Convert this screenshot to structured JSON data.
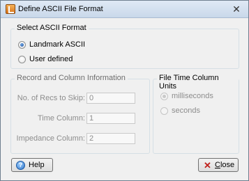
{
  "window": {
    "title": "Define ASCII File Format",
    "close_glyph": "✕"
  },
  "format_group": {
    "label": "Select ASCII Format",
    "options": [
      {
        "label": "Landmark ASCII",
        "checked": true
      },
      {
        "label": "User defined",
        "checked": false
      }
    ]
  },
  "record_group": {
    "label": "Record and Column Information",
    "fields": [
      {
        "label": "No. of Recs to Skip:",
        "value": "0"
      },
      {
        "label": "Time Column:",
        "value": "1"
      },
      {
        "label": "Impedance Column:",
        "value": "2"
      }
    ]
  },
  "units_group": {
    "label": "File Time Column Units",
    "options": [
      {
        "label": "milliseconds",
        "checked": true
      },
      {
        "label": "seconds",
        "checked": false
      }
    ]
  },
  "buttons": {
    "help_label": "Help",
    "help_icon_glyph": "?",
    "close_label_first": "C",
    "close_label_rest": "lose",
    "close_icon_glyph": "✕"
  },
  "colors": {
    "disabled_text": "#8d8d8d",
    "close_icon": "#c0201b",
    "help_icon": "#2f75c9"
  }
}
